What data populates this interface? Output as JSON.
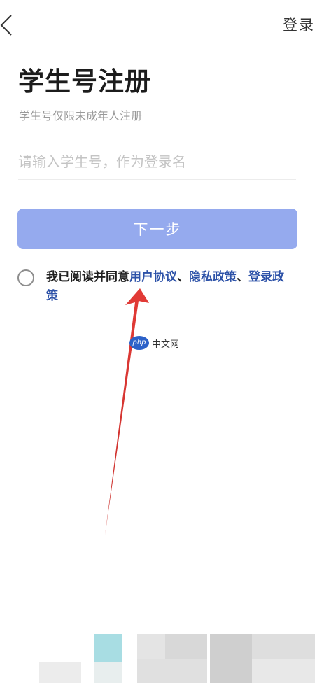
{
  "header": {
    "back_icon": "chevron-left-icon",
    "login_link": "登录"
  },
  "main": {
    "title": "学生号注册",
    "subtitle": "学生号仅限未成年人注册",
    "student_input": {
      "placeholder": "请输入学生号，作为登录名",
      "value": ""
    },
    "next_button": "下一步",
    "agreement": {
      "checked": false,
      "prefix": "我已阅读并同意",
      "user_agreement": "用户协议",
      "separator1": "、",
      "privacy_policy": "隐私政策",
      "separator2": "、",
      "login_policy": "登录政策"
    }
  },
  "watermark": {
    "badge": "php",
    "text": "中文网"
  },
  "colors": {
    "primary_button": "#95aaee",
    "link": "#2d52a8",
    "subtitle": "#9a9a9a",
    "annotation_arrow": "#e0403c"
  }
}
